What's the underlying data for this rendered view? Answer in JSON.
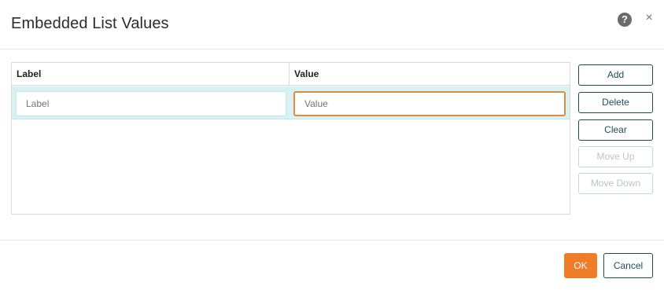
{
  "dialog": {
    "title": "Embedded List Values",
    "help_icon": "question-circle-icon",
    "help_glyph": "?",
    "close_icon": "close-icon",
    "close_glyph": "×"
  },
  "grid": {
    "columns": [
      "Label",
      "Value"
    ],
    "rows": [
      {
        "label_placeholder": "Label",
        "value_placeholder": "Value",
        "label_value": "",
        "value_value": ""
      }
    ]
  },
  "side_buttons": {
    "add": "Add",
    "delete": "Delete",
    "clear": "Clear",
    "move_up": "Move Up",
    "move_down": "Move Down"
  },
  "footer": {
    "ok": "OK",
    "cancel": "Cancel"
  },
  "colors": {
    "accent": "#ef7c26",
    "primary_outline": "#1f4d57",
    "selected_row": "#d8f2f3"
  }
}
